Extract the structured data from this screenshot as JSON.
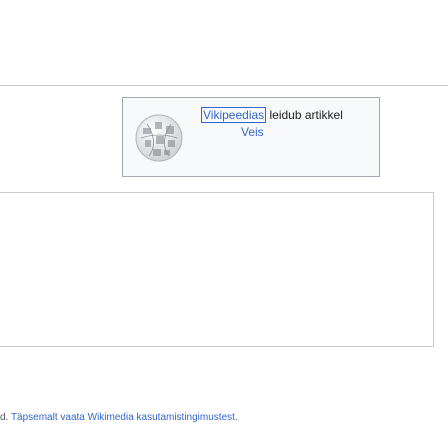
{
  "wikibox": {
    "link_label": "Vikipeedias",
    "suffix": " leidub artikkel",
    "article_link": "Veis",
    "globe_icon": "wikipedia-globe-icon"
  },
  "footer": {
    "prefix": "d. ",
    "text": "Täpsemalt vaata Wikimedia kasutamistingimustest."
  }
}
